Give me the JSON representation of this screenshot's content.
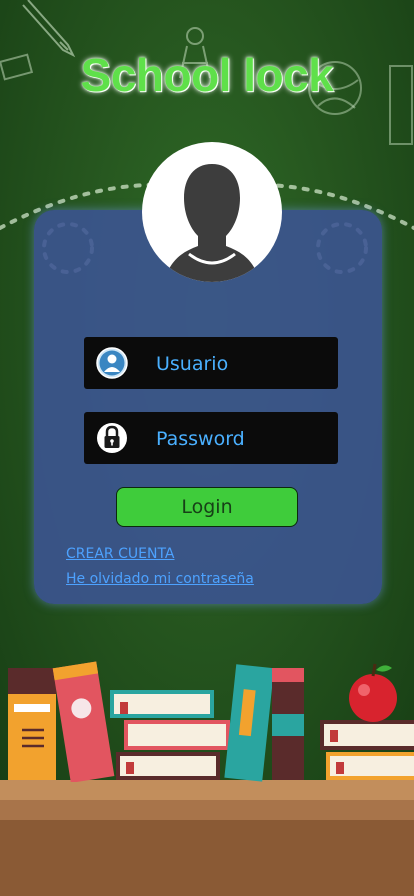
{
  "app": {
    "title": "School lock"
  },
  "login_form": {
    "username_placeholder": "Usuario",
    "password_placeholder": "Password",
    "login_label": "Login"
  },
  "links": {
    "create_account": "CREAR CUENTA",
    "forgot_password": "He olvidado mi contraseña"
  },
  "icons": {
    "avatar": "user-silhouette-icon",
    "username": "user-icon",
    "password": "padlock-icon"
  },
  "colors": {
    "title": "#5fe04a",
    "card": "#3c5494",
    "input_background": "#0b0b0b",
    "input_text": "#4ab0ff",
    "login_button": "#3fcc3b",
    "link": "#4da2ff"
  }
}
